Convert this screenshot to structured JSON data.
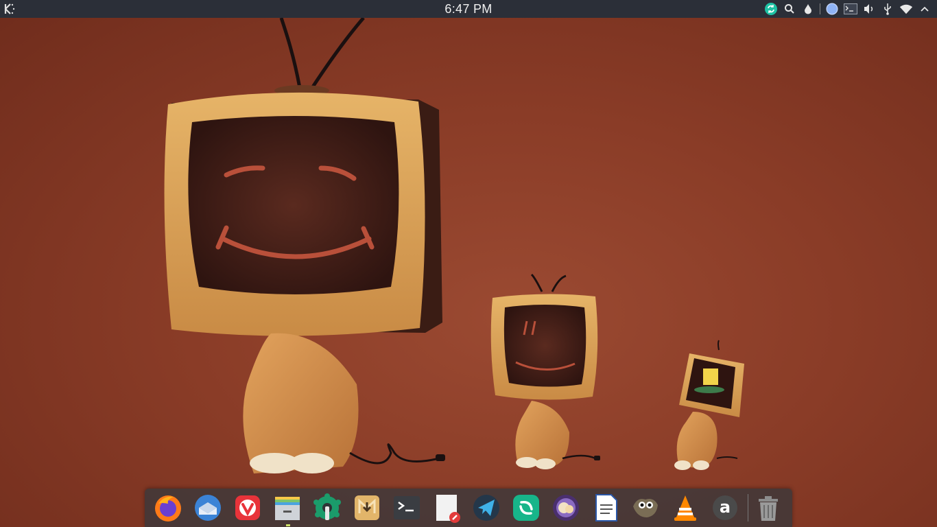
{
  "panel": {
    "clock": "6:47 PM",
    "tray_icons": [
      "sync-icon",
      "search-icon",
      "dropper-icon",
      "color-picker-icon",
      "terminal-icon",
      "volume-icon",
      "usb-icon",
      "wifi-icon",
      "expand-icon"
    ]
  },
  "dock": {
    "apps": [
      {
        "name": "firefox",
        "icon": "firefox-icon"
      },
      {
        "name": "thunderbird",
        "icon": "thunderbird-icon"
      },
      {
        "name": "vivaldi",
        "icon": "vivaldi-icon"
      },
      {
        "name": "file-manager",
        "icon": "file-manager-icon",
        "running": true
      },
      {
        "name": "settings",
        "icon": "settings-icon"
      },
      {
        "name": "mailspring",
        "icon": "mailspring-icon"
      },
      {
        "name": "terminal",
        "icon": "terminal-icon"
      },
      {
        "name": "text-editor",
        "icon": "text-editor-icon"
      },
      {
        "name": "telegram",
        "icon": "telegram-icon"
      },
      {
        "name": "element",
        "icon": "element-icon"
      },
      {
        "name": "cantata",
        "icon": "cantata-icon"
      },
      {
        "name": "writer",
        "icon": "writer-icon"
      },
      {
        "name": "gimp",
        "icon": "gimp-icon"
      },
      {
        "name": "vlc",
        "icon": "vlc-icon"
      },
      {
        "name": "amazon",
        "icon": "amazon-icon",
        "label": "a"
      },
      {
        "name": "trash",
        "icon": "trash-icon"
      }
    ]
  },
  "colors": {
    "panel_bg": "#2b2f38",
    "desktop_bg": "#8a3c27",
    "tv_frame": "#d9a35a",
    "tv_screen": "#3a1a14"
  }
}
